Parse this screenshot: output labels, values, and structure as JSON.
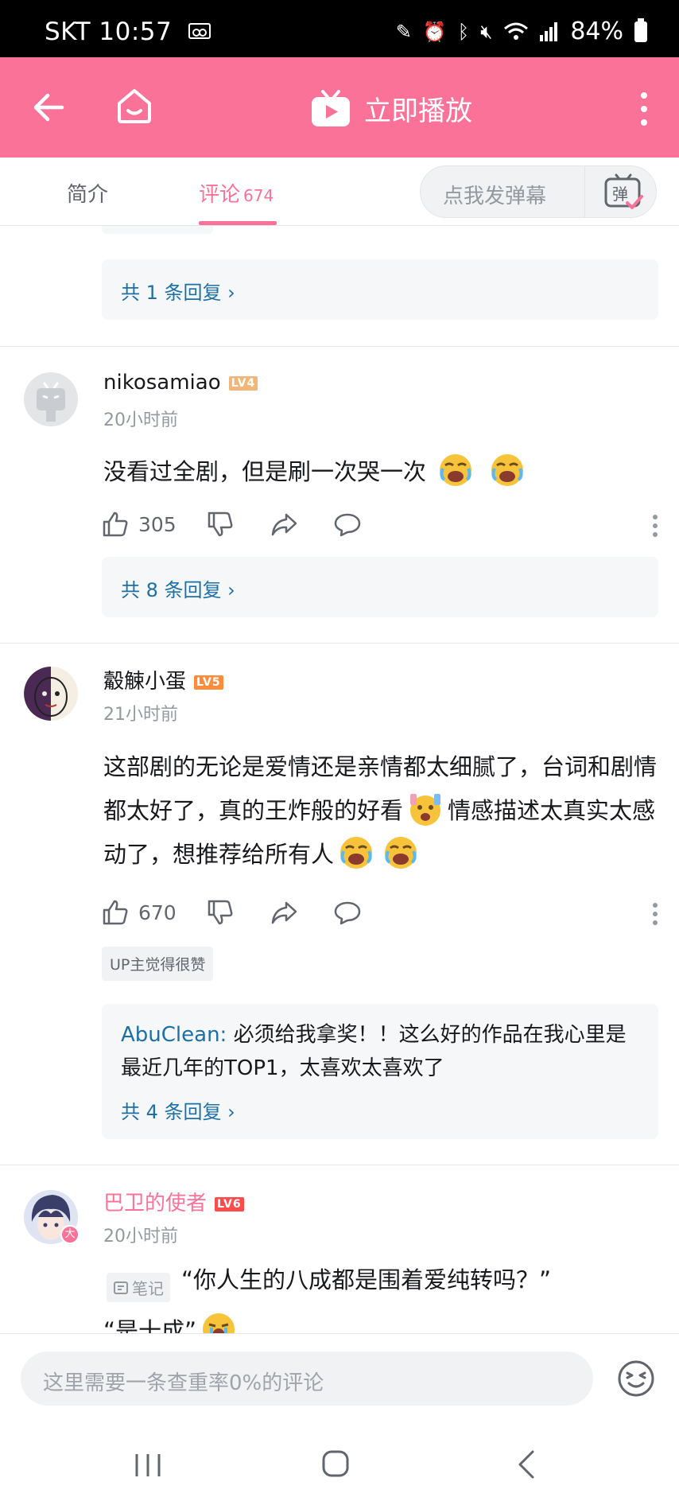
{
  "status_bar": {
    "carrier": "SKT",
    "time": "10:57",
    "battery": "84%"
  },
  "app_bar": {
    "play_label": "立即播放"
  },
  "tabs": {
    "intro": "简介",
    "comments": "评论",
    "comment_count": "674"
  },
  "danmu": {
    "placeholder": "点我发弹幕",
    "icon_text": "弹"
  },
  "feed": {
    "first_reply_more": "共 1 条回复 ›",
    "comments": [
      {
        "username": "nikosamiao",
        "level": "LV4",
        "level_color": "#f2b778",
        "time": "20小时前",
        "text": "没看过全剧，但是刷一次哭一次",
        "likes": "305",
        "reply_more": "共 8 条回复 ›"
      },
      {
        "username": "觳觫小蛋",
        "level": "LV5",
        "level_color": "#ff8c3a",
        "time": "21小时前",
        "text_1": "这部剧的无论是爱情还是亲情都太细腻了，台词和剧情都太好了，真的王炸般的好看",
        "text_2": "情感描述太真实太感动了，想推荐给所有人",
        "likes": "670",
        "up_badge": "UP主觉得很赞",
        "reply_user": "AbuClean:",
        "reply_text": "必须给我拿奖！！这么好的作品在我心里是最近几年的TOP1，太喜欢太喜欢了",
        "reply_more": "共 4 条回复 ›"
      },
      {
        "username": "巴卫的使者",
        "username_color": "#fb7299",
        "level": "LV6",
        "level_color": "#ff4b4b",
        "time": "20小时前",
        "note_tag": "笔记",
        "text": "“你人生的八成都是围着爱纯转吗？”",
        "text_cut": "“是十成”"
      }
    ]
  },
  "bottom_input": {
    "placeholder": "这里需要一条查重率0%的评论"
  }
}
